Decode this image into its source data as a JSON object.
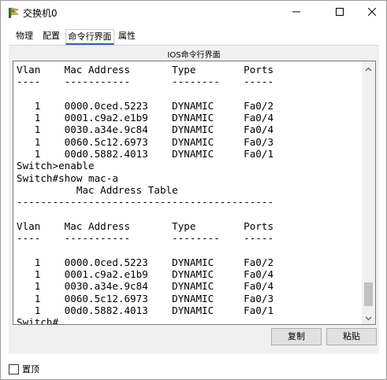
{
  "window": {
    "title": "交换机0"
  },
  "tabs": [
    {
      "label": "物理"
    },
    {
      "label": "配置"
    },
    {
      "label": "命令行界面",
      "active": true
    },
    {
      "label": "属性"
    }
  ],
  "panel": {
    "caption": "IOS命令行界面"
  },
  "terminal": {
    "lines": [
      "Vlan    Mac Address       Type        Ports",
      "----    -----------       --------    -----",
      "",
      "   1    0000.0ced.5223    DYNAMIC     Fa0/2",
      "   1    0001.c9a2.e1b9    DYNAMIC     Fa0/4",
      "   1    0030.a34e.9c84    DYNAMIC     Fa0/4",
      "   1    0060.5c12.6973    DYNAMIC     Fa0/3",
      "   1    00d0.5882.4013    DYNAMIC     Fa0/1",
      "Switch>enable",
      "Switch#show mac-a",
      "          Mac Address Table",
      "-------------------------------------------",
      "",
      "Vlan    Mac Address       Type        Ports",
      "----    -----------       --------    -----",
      "",
      "   1    0000.0ced.5223    DYNAMIC     Fa0/2",
      "   1    0001.c9a2.e1b9    DYNAMIC     Fa0/4",
      "   1    0030.a34e.9c84    DYNAMIC     Fa0/4",
      "   1    0060.5c12.6973    DYNAMIC     Fa0/3",
      "   1    00d0.5882.4013    DYNAMIC     Fa0/1",
      "Switch#"
    ]
  },
  "buttons": {
    "copy": "复制",
    "paste": "粘贴"
  },
  "footer": {
    "topmost_label": "置顶",
    "topmost_checked": false
  },
  "colors": {
    "tab_underline": "#2a63b0",
    "panel_bg": "#f0f0f0",
    "terminal_bg": "#ffffff"
  },
  "icons": {
    "app": "switch-icon",
    "minimize": "minimize-icon",
    "maximize": "maximize-icon",
    "close": "close-icon",
    "scroll_up": "chevron-up-icon",
    "scroll_down": "chevron-down-icon"
  }
}
